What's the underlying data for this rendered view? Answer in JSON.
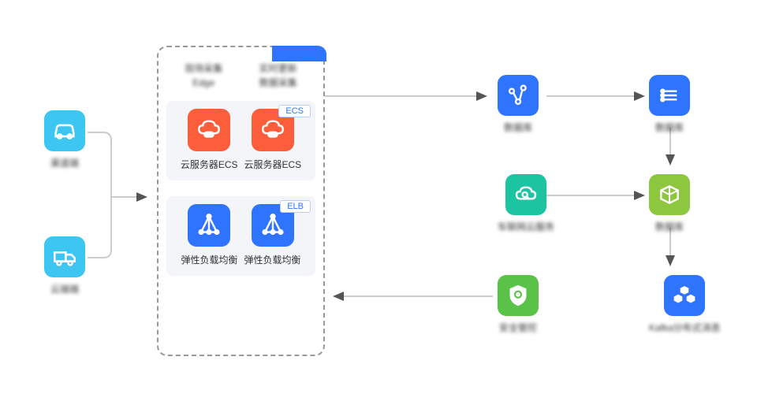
{
  "left": {
    "car": "渠道端",
    "truck": "云端端"
  },
  "center": {
    "header": {
      "h1_l1": "现场采集",
      "h1_l2": "Edge",
      "h2_l1": "实时更新",
      "h2_l2": "数据采集"
    },
    "ecs": {
      "badge": "ECS",
      "label": "云服务器ECS"
    },
    "elb": {
      "badge": "ELB",
      "label": "弹性负载均衡"
    }
  },
  "right": {
    "graph": "数据库",
    "stack": "数据库",
    "cloud": "车联网云服务",
    "shield": "安全管控",
    "cube": "数据库",
    "cluster": "Kafka分布式消息"
  }
}
